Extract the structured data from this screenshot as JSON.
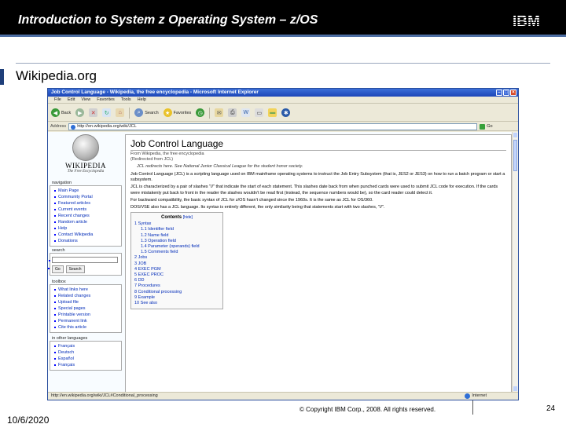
{
  "slide": {
    "title": "Introduction to System z Operating System – z/OS",
    "subtitle": "Wikipedia.org",
    "date": "10/6/2020",
    "copyright": "© Copyright IBM Corp., 2008. All rights reserved.",
    "page_number": "24",
    "logo": "IBM"
  },
  "browser": {
    "window_title": "Job Control Language - Wikipedia, the free encyclopedia - Microsoft Internet Explorer",
    "menu": [
      "File",
      "Edit",
      "View",
      "Favorites",
      "Tools",
      "Help"
    ],
    "toolbar": {
      "back": "Back",
      "search": "Search",
      "favorites": "Favorites"
    },
    "address_label": "Address",
    "address_value": "http://en.wikipedia.org/wiki/JCL",
    "go_label": "Go",
    "status_url": "http://en.wikipedia.org/wiki/JCL#Conditional_processing",
    "status_zone": "Internet"
  },
  "wikipedia": {
    "logo_name": "WIKIPEDIA",
    "logo_tagline": "The Free Encyclopedia",
    "navigation": {
      "heading": "navigation",
      "items": [
        "Main Page",
        "Community Portal",
        "Featured articles",
        "Current events",
        "Recent changes",
        "Random article",
        "Help",
        "Contact Wikipedia",
        "Donations"
      ]
    },
    "search": {
      "heading": "search",
      "go_button": "Go",
      "search_button": "Search"
    },
    "toolbox": {
      "heading": "toolbox",
      "items": [
        "What links here",
        "Related changes",
        "Upload file",
        "Special pages",
        "Printable version",
        "Permanent link",
        "Cite this article"
      ]
    },
    "languages": {
      "heading": "in other languages",
      "items": [
        "Français",
        "Deutsch",
        "Español",
        "Français"
      ]
    },
    "article": {
      "title": "Job Control Language",
      "from_line": "From Wikipedia, the free encyclopedia",
      "redirect_line": "(Redirected from JCL)",
      "hatnote": "JCL redirects here. See National Junior Classical League for the student honor society.",
      "paragraphs": [
        "Job Control Language (JCL) is a scripting language used on IBM mainframe operating systems to instruct the Job Entry Subsystem (that is, JES2 or JES3) on how to run a batch program or start a subsystem.",
        "JCL is characterized by a pair of slashes \"//\" that indicate the start of each statement. This slashes date back from when punched cards were used to submit JCL code for execution. If the cards were mistakenly put back to front in the reader the slashes wouldn't be read first (instead, the sequence numbers would be), so the card reader could detect it.",
        "For backward compatibility, the basic syntax of JCL for z/OS hasn't changed since the 1960s. It is the same as JCL for OS/360.",
        "DOS/VSE also has a JCL language. Its syntax is entirely different, the only similarity being that statements start with two slashes, \"//\"."
      ]
    },
    "toc": {
      "title": "Contents",
      "hide": "[hide]",
      "items": [
        {
          "text": "1 Syntax",
          "level": 1
        },
        {
          "text": "1.1 Identifier field",
          "level": 2
        },
        {
          "text": "1.2 Name field",
          "level": 2
        },
        {
          "text": "1.3 Operation field",
          "level": 2
        },
        {
          "text": "1.4 Parameter (operands) field",
          "level": 2
        },
        {
          "text": "1.5 Comments field",
          "level": 2
        },
        {
          "text": "2 Jobs",
          "level": 1
        },
        {
          "text": "3 JOB",
          "level": 1
        },
        {
          "text": "4 EXEC PGM",
          "level": 1
        },
        {
          "text": "5 EXEC PROC",
          "level": 1
        },
        {
          "text": "6 DD",
          "level": 1
        },
        {
          "text": "7 Procedures",
          "level": 1
        },
        {
          "text": "8 Conditional processing",
          "level": 1
        },
        {
          "text": "9 Example",
          "level": 1
        },
        {
          "text": "10 See also",
          "level": 1
        }
      ]
    }
  }
}
